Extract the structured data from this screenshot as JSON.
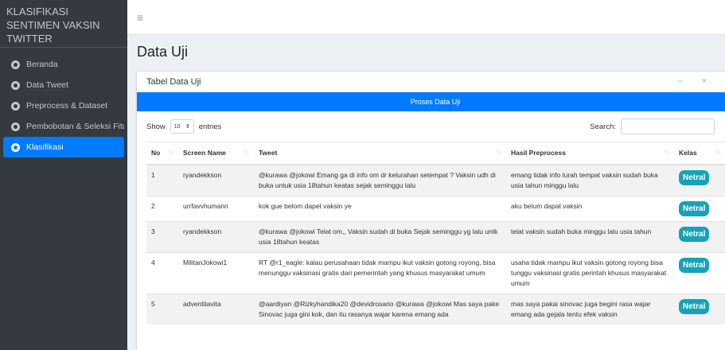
{
  "sidebar": {
    "brand": "KLASIFIKASI SENTIMEN VAKSIN TWITTER",
    "items": [
      {
        "label": "Beranda",
        "active": false
      },
      {
        "label": "Data Tweet",
        "active": false
      },
      {
        "label": "Preprocess & Dataset",
        "active": false
      },
      {
        "label": "Pembobotan & Seleksi Fitur",
        "active": false
      },
      {
        "label": "Klasifikasi",
        "active": true
      }
    ]
  },
  "topbar": {
    "menu_icon": "≡"
  },
  "page": {
    "title": "Data Uji"
  },
  "card": {
    "title": "Tabel Data Uji",
    "tools": "– ×",
    "process_button": "Proses Data Uji"
  },
  "controls": {
    "show_label": "Show",
    "entries_value": "10",
    "entries_label": "entries",
    "search_label": "Search:",
    "search_value": ""
  },
  "table": {
    "columns": [
      "No",
      "Screen Name",
      "Tweet",
      "Hasil Preprocess",
      "Kelas"
    ],
    "rows": [
      {
        "no": "1",
        "screen_name": "ryandekkson",
        "tweet": "@kurawa @jokowi Emang ga di info om dr kelurahan setempat ? Vaksin udh di buka untuk usia 18tahun keatas sejak seminggu lalu",
        "preprocess": "emang tidak info lurah tempat vaksin sudah buka usia tahun minggu lalu",
        "kelas": "Netral"
      },
      {
        "no": "2",
        "screen_name": "urrfavvhumann",
        "tweet": "kok gue belom dapet vaksin ye",
        "preprocess": "aku belum dapat vaksin",
        "kelas": "Netral"
      },
      {
        "no": "3",
        "screen_name": "ryandekkson",
        "tweet": "@kurawa @jokowi Telat om,, Vaksin sudah di buka Sejak seminggu yg lalu untk usia 18tahun keatas",
        "preprocess": "telat vaksin sudah buka minggu lalu usia tahun",
        "kelas": "Netral"
      },
      {
        "no": "4",
        "screen_name": "MilitanJokowi1",
        "tweet": "RT @r1_eagle: kalau perusahaan tidak mampu ikut vaksin gotong royong, bisa menunggu vaksinasi gratis dari pemerintah yang khusus masyarakat umum",
        "preprocess": "usaha tidak mampu ikut vaksin gotong royong bisa tunggu vaksinasi gratis perintah khusus masyarakat umum",
        "kelas": "Netral"
      },
      {
        "no": "5",
        "screen_name": "adventitavita",
        "tweet": "@aardiyan @Rizkyhandika20 @devidrosario @kurawa @jokowi Mas saya pake Sinovac juga gini kok, dan itu rasanya wajar karena emang ada",
        "preprocess": "mas saya pakai sinovac juga begini rasa wajar emang ada gejala tentu efek vaksin",
        "kelas": "Netral"
      }
    ]
  },
  "colors": {
    "sidebar": "#343a40",
    "accent": "#007bff",
    "badge": "#17a2b8"
  }
}
